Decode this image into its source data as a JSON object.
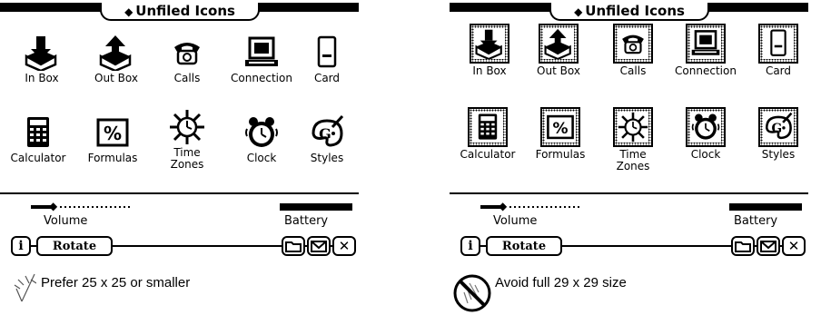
{
  "left": {
    "title": "Unfiled Icons",
    "icons": [
      {
        "label": "In Box",
        "icon": "in-box-icon"
      },
      {
        "label": "Out Box",
        "icon": "out-box-icon"
      },
      {
        "label": "Calls",
        "icon": "phone-icon"
      },
      {
        "label": "Connection",
        "icon": "computer-icon"
      },
      {
        "label": "Card",
        "icon": "card-icon"
      },
      {
        "label": "Calculator",
        "icon": "calculator-icon"
      },
      {
        "label": "Formulas",
        "icon": "percent-icon"
      },
      {
        "label": "Time\nZones",
        "icon": "sun-icon"
      },
      {
        "label": "Clock",
        "icon": "alarm-clock-icon"
      },
      {
        "label": "Styles",
        "icon": "palette-icon"
      }
    ],
    "volume_label": "Volume",
    "battery_label": "Battery",
    "info_label": "i",
    "rotate_label": "Rotate",
    "close_label": "✕",
    "caption": "Prefer 25 x 25 or smaller"
  },
  "right": {
    "title": "Unfiled Icons",
    "icons": [
      {
        "label": "In Box",
        "icon": "in-box-icon"
      },
      {
        "label": "Out Box",
        "icon": "out-box-icon"
      },
      {
        "label": "Calls",
        "icon": "phone-icon"
      },
      {
        "label": "Connection",
        "icon": "computer-icon"
      },
      {
        "label": "Card",
        "icon": "card-icon"
      },
      {
        "label": "Calculator",
        "icon": "calculator-icon"
      },
      {
        "label": "Formulas",
        "icon": "percent-icon"
      },
      {
        "label": "Time\nZones",
        "icon": "sun-icon"
      },
      {
        "label": "Clock",
        "icon": "alarm-clock-icon"
      },
      {
        "label": "Styles",
        "icon": "palette-icon"
      }
    ],
    "volume_label": "Volume",
    "battery_label": "Battery",
    "info_label": "i",
    "rotate_label": "Rotate",
    "close_label": "✕",
    "caption": "Avoid full 29 x 29 size"
  }
}
